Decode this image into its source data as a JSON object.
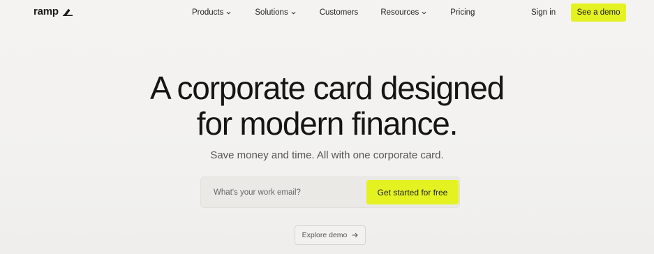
{
  "brand": {
    "name": "ramp",
    "accent_color": "#e4f222"
  },
  "nav": {
    "items": [
      {
        "label": "Products",
        "has_dropdown": true
      },
      {
        "label": "Solutions",
        "has_dropdown": true
      },
      {
        "label": "Customers",
        "has_dropdown": false
      },
      {
        "label": "Resources",
        "has_dropdown": true
      },
      {
        "label": "Pricing",
        "has_dropdown": false
      }
    ],
    "sign_in": "Sign in",
    "demo_button": "See a demo"
  },
  "hero": {
    "title_line1": "A corporate card designed",
    "title_line2": "for modern finance.",
    "subtitle": "Save money and time. All with one corporate card.",
    "email_placeholder": "What's your work email?",
    "email_value": "",
    "cta_label": "Get started for free",
    "explore_label": "Explore demo"
  }
}
